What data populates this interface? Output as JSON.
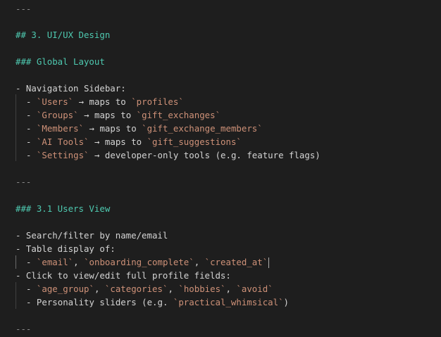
{
  "document": {
    "hr": "---",
    "section_heading": "## 3. UI/UX Design",
    "global_layout_heading": "### Global Layout",
    "nav_intro": "- Navigation Sidebar:",
    "nav_items": [
      {
        "lead": "- ",
        "tick1": "`Users`",
        "mid": " → maps to ",
        "tick2": "`profiles`",
        "tail": ""
      },
      {
        "lead": "- ",
        "tick1": "`Groups`",
        "mid": " → maps to ",
        "tick2": "`gift_exchanges`",
        "tail": ""
      },
      {
        "lead": "- ",
        "tick1": "`Members`",
        "mid": " → maps to ",
        "tick2": "`gift_exchange_members`",
        "tail": ""
      },
      {
        "lead": "- ",
        "tick1": "`AI Tools`",
        "mid": " → maps to ",
        "tick2": "`gift_suggestions`",
        "tail": ""
      },
      {
        "lead": "- ",
        "tick1": "`Settings`",
        "mid": " → developer-only tools (e.g. feature flags)",
        "tick2": "",
        "tail": ""
      }
    ],
    "users_view_heading": "### 3.1 Users View",
    "users_items": {
      "search": "- Search/filter by name/email",
      "table": "- Table display of:",
      "table_sub": {
        "lead": "- ",
        "c1": "`email`",
        "s1": ", ",
        "c2": "`onboarding_complete`",
        "s2": ", ",
        "c3": "`created_at`"
      },
      "click": "- Click to view/edit full profile fields:",
      "fields_sub": {
        "lead": "- ",
        "c1": "`age_group`",
        "s1": ", ",
        "c2": "`categories`",
        "s2": ", ",
        "c3": "`hobbies`",
        "s3": ", ",
        "c4": "`avoid`"
      },
      "sliders_sub": {
        "lead": "- Personality sliders (e.g. ",
        "c1": "`practical_whimsical`",
        "tail": ")"
      }
    }
  },
  "colors": {
    "background": "#1e1e1e",
    "heading": "#4ec9b0",
    "inline_code": "#ce9178",
    "text": "#d4d4d4"
  }
}
